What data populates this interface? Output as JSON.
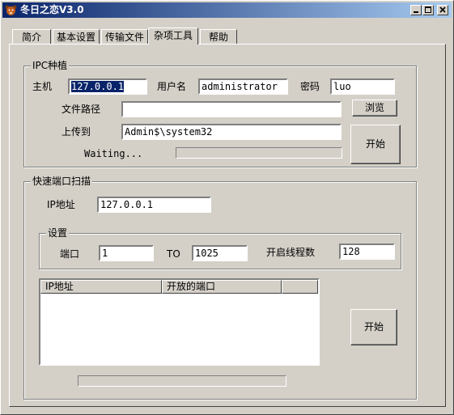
{
  "window": {
    "title": "冬日之恋V3.0",
    "app_icon": "bear-face-icon",
    "controls": {
      "minimize": "minimize-icon",
      "maximize": "maximize-icon",
      "close": "close-icon"
    }
  },
  "tabs": [
    {
      "label": "简介",
      "active": false
    },
    {
      "label": "基本设置",
      "active": false
    },
    {
      "label": "传输文件",
      "active": false
    },
    {
      "label": "杂项工具",
      "active": true
    },
    {
      "label": "帮助",
      "active": false
    }
  ],
  "ipc": {
    "group_title": "IPC种植",
    "host_label": "主机",
    "host_value": "127.0.0.1",
    "user_label": "用户名",
    "user_value": "administrator",
    "password_label": "密码",
    "password_value": "luo",
    "path_label": "文件路径",
    "path_value": "",
    "browse_label": "浏览",
    "upload_label": "上传到",
    "upload_value": "Admin$\\system32",
    "status_text": "Waiting...",
    "progress": 0,
    "start_label": "开始"
  },
  "scan": {
    "group_title": "快速端口扫描",
    "ip_label": "IP地址",
    "ip_value": "127.0.0.1",
    "settings_title": "设置",
    "port_label": "端口",
    "port_from": "1",
    "to_label": "TO",
    "port_to": "1025",
    "threads_label": "开启线程数",
    "threads_value": "128",
    "columns": [
      "IP地址",
      "开放的端口",
      ""
    ],
    "start_label": "开始",
    "progress": 0
  },
  "colors": {
    "titlebar_start": "#0a246a",
    "titlebar_end": "#a6caf0",
    "face": "#d4d0c8"
  }
}
